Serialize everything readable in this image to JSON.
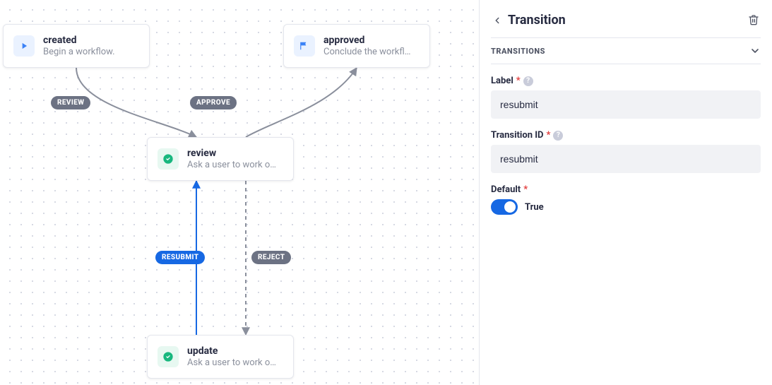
{
  "panel": {
    "title": "Transition",
    "section": "TRANSITIONS",
    "fields": {
      "label": {
        "label": "Label",
        "value": "resubmit"
      },
      "transition_id": {
        "label": "Transition ID",
        "value": "resubmit"
      },
      "default": {
        "label": "Default",
        "value": "True"
      }
    }
  },
  "nodes": {
    "created": {
      "title": "created",
      "sub": "Begin a workflow."
    },
    "approved": {
      "title": "approved",
      "sub": "Conclude the workfl…"
    },
    "review": {
      "title": "review",
      "sub": "Ask a user to work o…"
    },
    "update": {
      "title": "update",
      "sub": "Ask a user to work o…"
    }
  },
  "edges": {
    "review": "REVIEW",
    "approve": "APPROVE",
    "resubmit": "RESUBMIT",
    "reject": "REJECT"
  }
}
